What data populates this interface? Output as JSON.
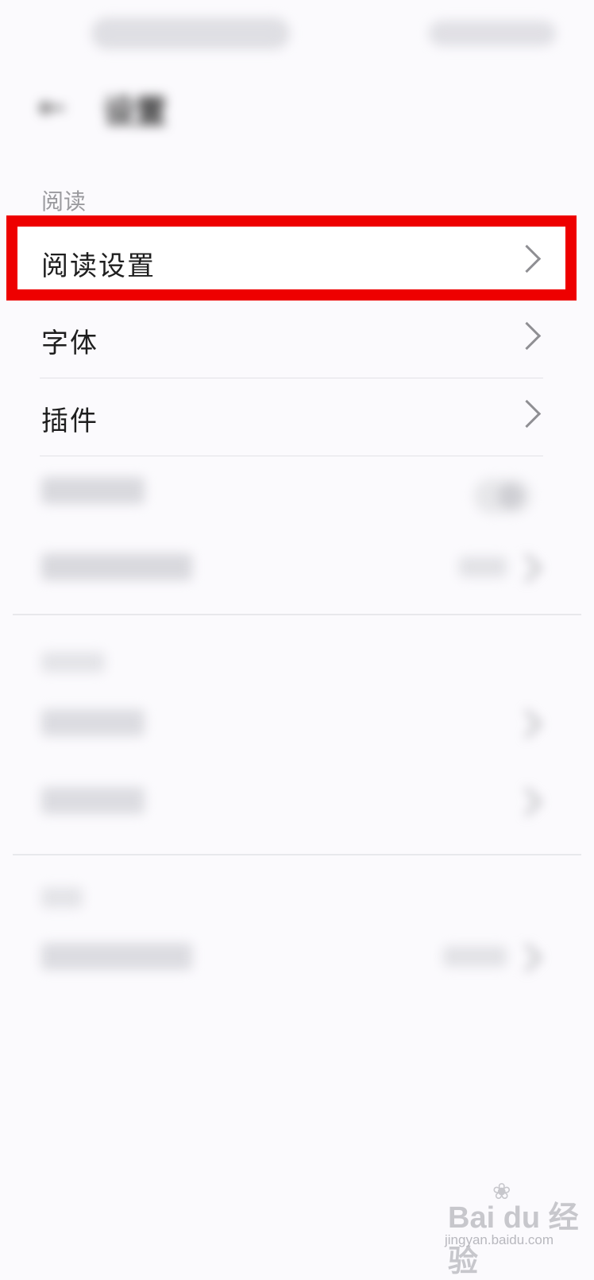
{
  "status_bar": {
    "left_text": "",
    "right_text": ""
  },
  "header": {
    "back_icon": "back-arrow-icon",
    "title": "设置"
  },
  "sections": {
    "reading_label": "阅读",
    "reading_settings": "阅读设置",
    "font": "字体",
    "plugins": "插件",
    "blurred_row_4": "",
    "blurred_row_5": "",
    "blurred_row_5_value": "",
    "section2_label": "",
    "blurred_row_6": "",
    "blurred_row_7": "",
    "section3_label": "",
    "blurred_row_8": "",
    "blurred_row_8_value": ""
  },
  "highlight_color": "#ee0000",
  "watermark": {
    "logo": "Bai du 经验",
    "url": "jingyan.baidu.com"
  }
}
